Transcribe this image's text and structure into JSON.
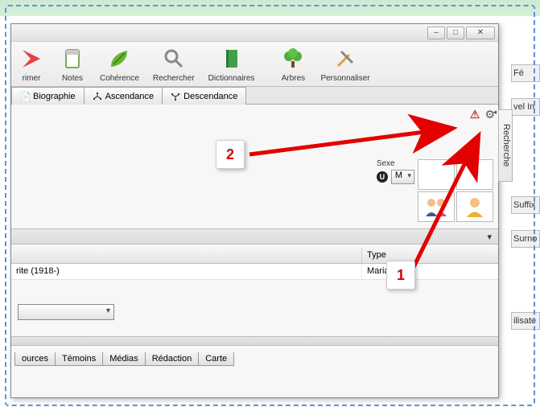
{
  "window": {
    "controls": {
      "min": "–",
      "max": "□",
      "close": "✕"
    }
  },
  "toolbar": {
    "items": [
      {
        "label": "rimer",
        "icon": "delete-icon"
      },
      {
        "label": "Notes",
        "icon": "notes-icon"
      },
      {
        "label": "Cohérence",
        "icon": "leaf-icon"
      },
      {
        "label": "Rechercher",
        "icon": "search-icon"
      },
      {
        "label": "Dictionnaires",
        "icon": "book-icon"
      },
      {
        "label": "Arbres",
        "icon": "tree-icon"
      },
      {
        "label": "Personnaliser",
        "icon": "tools-icon"
      }
    ]
  },
  "main_tabs": [
    {
      "label": "Biographie",
      "icon": "doc-icon"
    },
    {
      "label": "Ascendance",
      "icon": "up-tree-icon"
    },
    {
      "label": "Descendance",
      "icon": "down-tree-icon"
    }
  ],
  "top_right": {
    "alert": "⚠",
    "gear": "⚙"
  },
  "sexe": {
    "label": "Sexe",
    "value": "M",
    "badge": "U"
  },
  "midbar_caret": "▾",
  "list": {
    "type_header": "Type",
    "row_left": "rite (1918-)",
    "row_type": "Mariage"
  },
  "bottom_tabs": [
    "ources",
    "Témoins",
    "Médias",
    "Rédaction",
    "Carte"
  ],
  "right_tab": "Recherche",
  "right_window_hints": [
    "Fé",
    "vel In",
    "Suffix",
    "Surno",
    "ilisate"
  ],
  "callouts": {
    "one": "1",
    "two": "2"
  }
}
